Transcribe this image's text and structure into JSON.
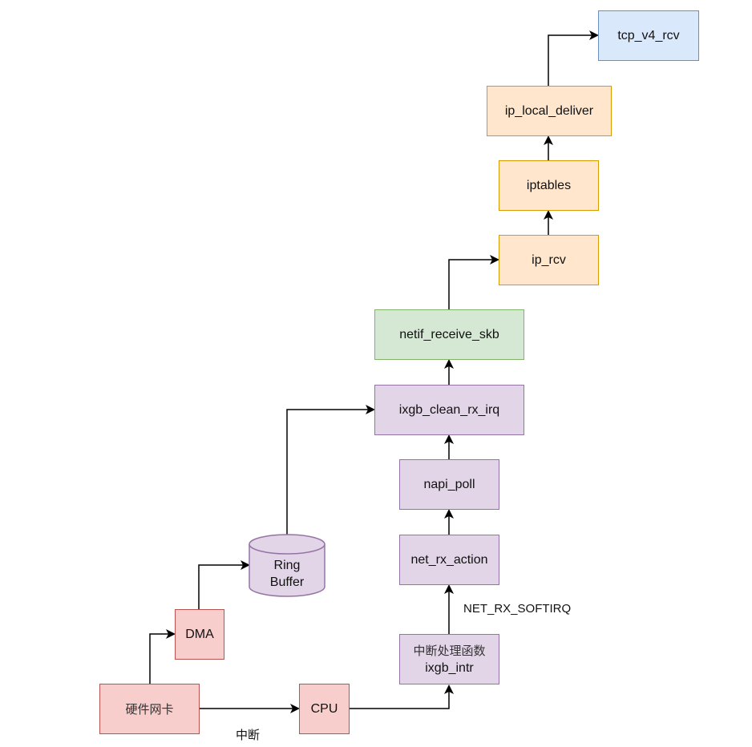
{
  "diagram": {
    "nodes": {
      "nic": "硬件网卡",
      "dma": "DMA",
      "ring_buffer_line1": "Ring",
      "ring_buffer_line2": "Buffer",
      "cpu": "CPU",
      "irq_handler_cn": "中断处理函数",
      "irq_handler_fn": "ixgb_intr",
      "net_rx_action": "net_rx_action",
      "napi_poll": "napi_poll",
      "ixgb_clean_rx_irq": "ixgb_clean_rx_irq",
      "netif_receive_skb": "netif_receive_skb",
      "ip_rcv": "ip_rcv",
      "iptables": "iptables",
      "ip_local_deliver": "ip_local_deliver",
      "tcp_v4_rcv": "tcp_v4_rcv"
    },
    "edge_labels": {
      "interrupt": "中断",
      "softirq": "NET_RX_SOFTIRQ"
    },
    "edges": [
      {
        "from": "nic",
        "to": "dma"
      },
      {
        "from": "dma",
        "to": "ring_buffer"
      },
      {
        "from": "ring_buffer",
        "to": "ixgb_clean_rx_irq"
      },
      {
        "from": "nic",
        "to": "cpu",
        "label": "interrupt"
      },
      {
        "from": "cpu",
        "to": "irq_handler"
      },
      {
        "from": "irq_handler",
        "to": "net_rx_action",
        "label": "softirq"
      },
      {
        "from": "net_rx_action",
        "to": "napi_poll"
      },
      {
        "from": "napi_poll",
        "to": "ixgb_clean_rx_irq"
      },
      {
        "from": "ixgb_clean_rx_irq",
        "to": "netif_receive_skb"
      },
      {
        "from": "netif_receive_skb",
        "to": "ip_rcv"
      },
      {
        "from": "ip_rcv",
        "to": "iptables"
      },
      {
        "from": "iptables",
        "to": "ip_local_deliver"
      },
      {
        "from": "ip_local_deliver",
        "to": "tcp_v4_rcv"
      }
    ],
    "colors": {
      "hardware_fill": "#f8cecc",
      "hardware_stroke": "#b85450",
      "driver_fill": "#e1d5e7",
      "driver_stroke": "#9673a6",
      "core_fill": "#d5e8d4",
      "core_stroke": "#82b366",
      "ip_fill": "#ffe6cc",
      "ip_stroke": "#d79b00",
      "tcp_fill": "#dae8fc",
      "tcp_stroke": "#6c8ebf"
    }
  }
}
